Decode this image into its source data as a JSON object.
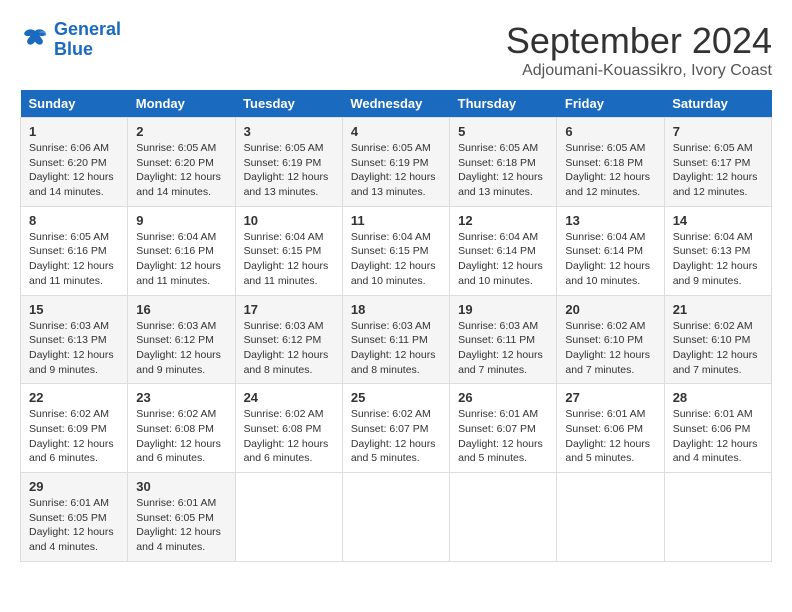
{
  "logo": {
    "line1": "General",
    "line2": "Blue"
  },
  "title": "September 2024",
  "subtitle": "Adjoumani-Kouassikro, Ivory Coast",
  "weekdays": [
    "Sunday",
    "Monday",
    "Tuesday",
    "Wednesday",
    "Thursday",
    "Friday",
    "Saturday"
  ],
  "weeks": [
    [
      {
        "day": "1",
        "sunrise": "6:06 AM",
        "sunset": "6:20 PM",
        "daylight": "12 hours and 14 minutes."
      },
      {
        "day": "2",
        "sunrise": "6:05 AM",
        "sunset": "6:20 PM",
        "daylight": "12 hours and 14 minutes."
      },
      {
        "day": "3",
        "sunrise": "6:05 AM",
        "sunset": "6:19 PM",
        "daylight": "12 hours and 13 minutes."
      },
      {
        "day": "4",
        "sunrise": "6:05 AM",
        "sunset": "6:19 PM",
        "daylight": "12 hours and 13 minutes."
      },
      {
        "day": "5",
        "sunrise": "6:05 AM",
        "sunset": "6:18 PM",
        "daylight": "12 hours and 13 minutes."
      },
      {
        "day": "6",
        "sunrise": "6:05 AM",
        "sunset": "6:18 PM",
        "daylight": "12 hours and 12 minutes."
      },
      {
        "day": "7",
        "sunrise": "6:05 AM",
        "sunset": "6:17 PM",
        "daylight": "12 hours and 12 minutes."
      }
    ],
    [
      {
        "day": "8",
        "sunrise": "6:05 AM",
        "sunset": "6:16 PM",
        "daylight": "12 hours and 11 minutes."
      },
      {
        "day": "9",
        "sunrise": "6:04 AM",
        "sunset": "6:16 PM",
        "daylight": "12 hours and 11 minutes."
      },
      {
        "day": "10",
        "sunrise": "6:04 AM",
        "sunset": "6:15 PM",
        "daylight": "12 hours and 11 minutes."
      },
      {
        "day": "11",
        "sunrise": "6:04 AM",
        "sunset": "6:15 PM",
        "daylight": "12 hours and 10 minutes."
      },
      {
        "day": "12",
        "sunrise": "6:04 AM",
        "sunset": "6:14 PM",
        "daylight": "12 hours and 10 minutes."
      },
      {
        "day": "13",
        "sunrise": "6:04 AM",
        "sunset": "6:14 PM",
        "daylight": "12 hours and 10 minutes."
      },
      {
        "day": "14",
        "sunrise": "6:04 AM",
        "sunset": "6:13 PM",
        "daylight": "12 hours and 9 minutes."
      }
    ],
    [
      {
        "day": "15",
        "sunrise": "6:03 AM",
        "sunset": "6:13 PM",
        "daylight": "12 hours and 9 minutes."
      },
      {
        "day": "16",
        "sunrise": "6:03 AM",
        "sunset": "6:12 PM",
        "daylight": "12 hours and 9 minutes."
      },
      {
        "day": "17",
        "sunrise": "6:03 AM",
        "sunset": "6:12 PM",
        "daylight": "12 hours and 8 minutes."
      },
      {
        "day": "18",
        "sunrise": "6:03 AM",
        "sunset": "6:11 PM",
        "daylight": "12 hours and 8 minutes."
      },
      {
        "day": "19",
        "sunrise": "6:03 AM",
        "sunset": "6:11 PM",
        "daylight": "12 hours and 7 minutes."
      },
      {
        "day": "20",
        "sunrise": "6:02 AM",
        "sunset": "6:10 PM",
        "daylight": "12 hours and 7 minutes."
      },
      {
        "day": "21",
        "sunrise": "6:02 AM",
        "sunset": "6:10 PM",
        "daylight": "12 hours and 7 minutes."
      }
    ],
    [
      {
        "day": "22",
        "sunrise": "6:02 AM",
        "sunset": "6:09 PM",
        "daylight": "12 hours and 6 minutes."
      },
      {
        "day": "23",
        "sunrise": "6:02 AM",
        "sunset": "6:08 PM",
        "daylight": "12 hours and 6 minutes."
      },
      {
        "day": "24",
        "sunrise": "6:02 AM",
        "sunset": "6:08 PM",
        "daylight": "12 hours and 6 minutes."
      },
      {
        "day": "25",
        "sunrise": "6:02 AM",
        "sunset": "6:07 PM",
        "daylight": "12 hours and 5 minutes."
      },
      {
        "day": "26",
        "sunrise": "6:01 AM",
        "sunset": "6:07 PM",
        "daylight": "12 hours and 5 minutes."
      },
      {
        "day": "27",
        "sunrise": "6:01 AM",
        "sunset": "6:06 PM",
        "daylight": "12 hours and 5 minutes."
      },
      {
        "day": "28",
        "sunrise": "6:01 AM",
        "sunset": "6:06 PM",
        "daylight": "12 hours and 4 minutes."
      }
    ],
    [
      {
        "day": "29",
        "sunrise": "6:01 AM",
        "sunset": "6:05 PM",
        "daylight": "12 hours and 4 minutes."
      },
      {
        "day": "30",
        "sunrise": "6:01 AM",
        "sunset": "6:05 PM",
        "daylight": "12 hours and 4 minutes."
      },
      null,
      null,
      null,
      null,
      null
    ]
  ]
}
